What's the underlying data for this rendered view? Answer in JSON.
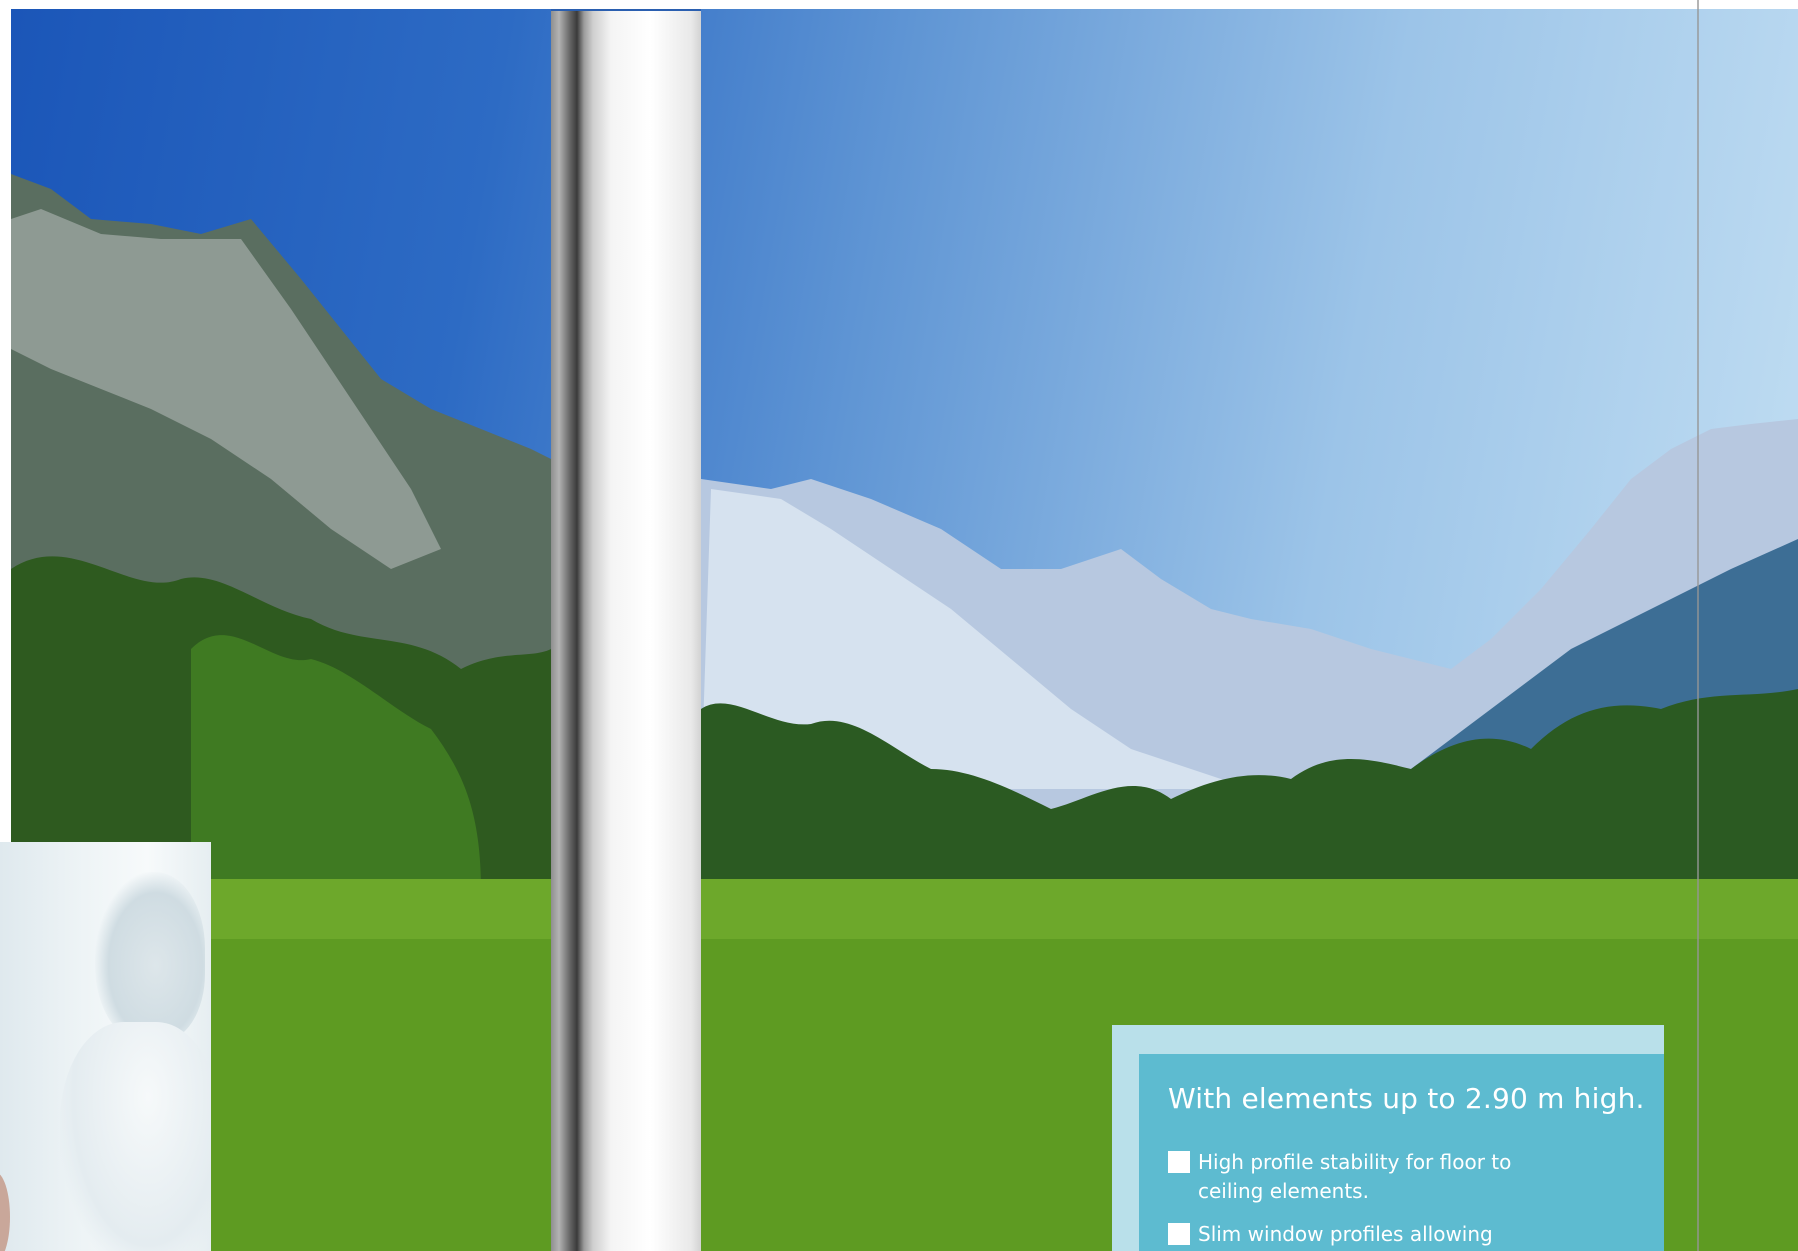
{
  "info_box": {
    "title": "With elements up to 2.90 m high.",
    "bullets": [
      {
        "line1": "High profile stability for floor to",
        "line2": "ceiling elements."
      },
      {
        "line1": "Slim window profiles allowing",
        "line2": ""
      }
    ]
  },
  "colors": {
    "info_box_background": "#5dbbd0",
    "info_box_border": "#b9e0ea",
    "text": "#ffffff"
  }
}
